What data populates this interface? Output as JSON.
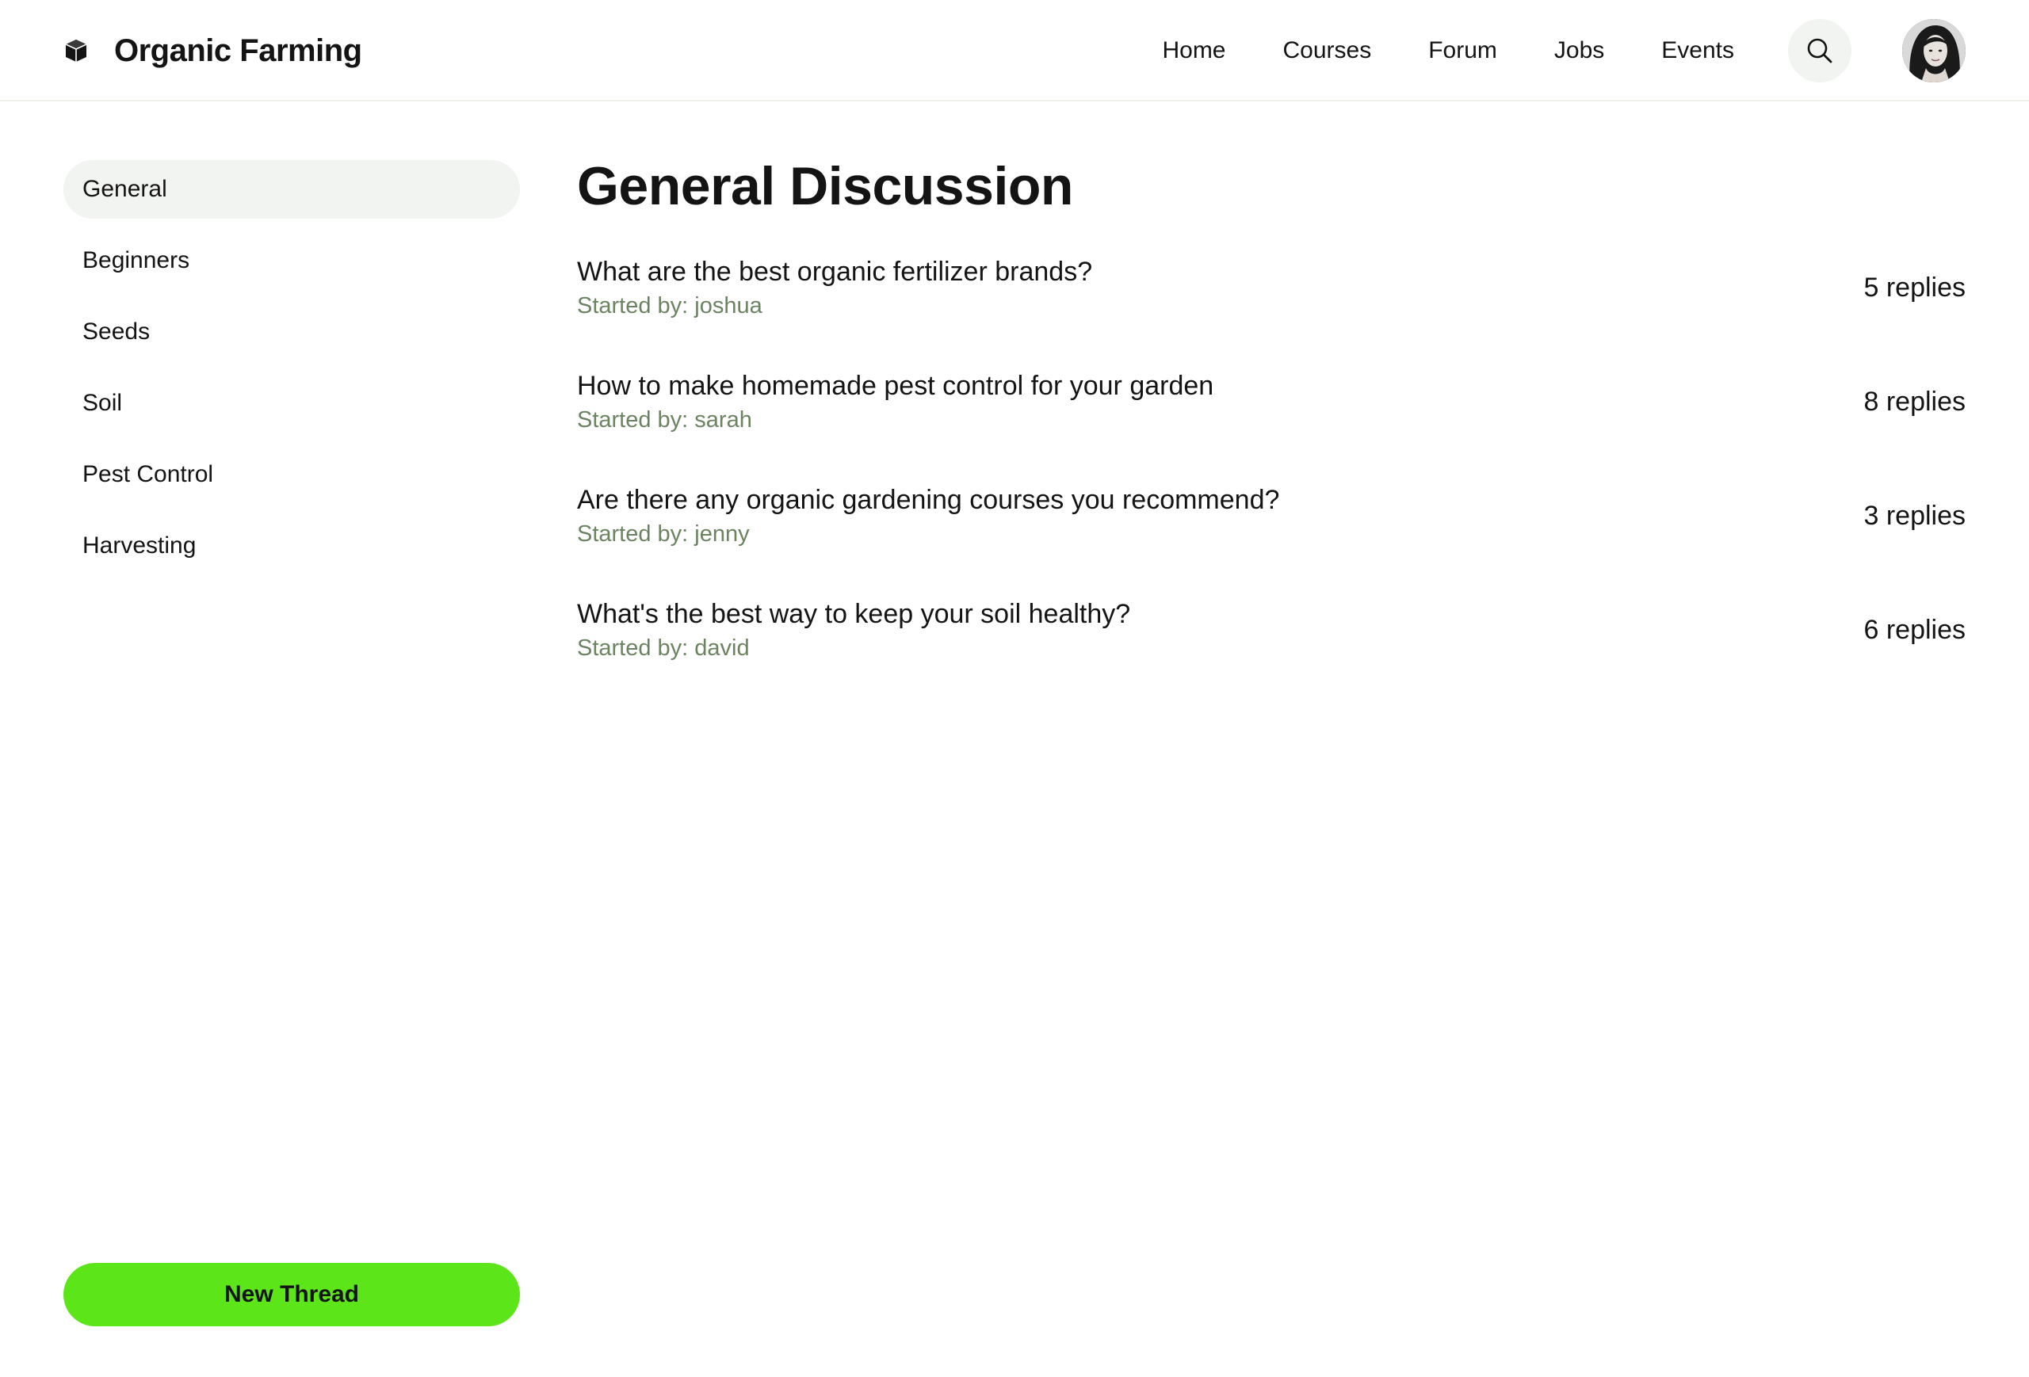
{
  "app": {
    "brand_name": "Organic Farming",
    "brand_icon": "cube-icon"
  },
  "nav": {
    "items": [
      "Home",
      "Courses",
      "Forum",
      "Jobs",
      "Events"
    ],
    "search_icon": "search-icon",
    "avatar_icon": "user-avatar"
  },
  "sidebar": {
    "items": [
      {
        "label": "General",
        "active": true
      },
      {
        "label": "Beginners",
        "active": false
      },
      {
        "label": "Seeds",
        "active": false
      },
      {
        "label": "Soil",
        "active": false
      },
      {
        "label": "Pest Control",
        "active": false
      },
      {
        "label": "Harvesting",
        "active": false
      }
    ],
    "new_thread_label": "New Thread"
  },
  "main": {
    "title": "General Discussion",
    "threads": [
      {
        "title": "What are the best organic fertilizer brands?",
        "author": "Started by: joshua",
        "replies": "5 replies"
      },
      {
        "title": "How to make homemade pest control for your garden",
        "author": "Started by: sarah",
        "replies": "8 replies"
      },
      {
        "title": "Are there any organic gardening courses you recommend?",
        "author": "Started by: jenny",
        "replies": "3 replies"
      },
      {
        "title": "What's the best way to keep your soil healthy?",
        "author": "Started by: david",
        "replies": "6 replies"
      }
    ]
  },
  "colors": {
    "accent": "#5ce619",
    "muted_green_text": "#6b8460",
    "active_bg": "#f2f4f1",
    "text": "#141414"
  }
}
